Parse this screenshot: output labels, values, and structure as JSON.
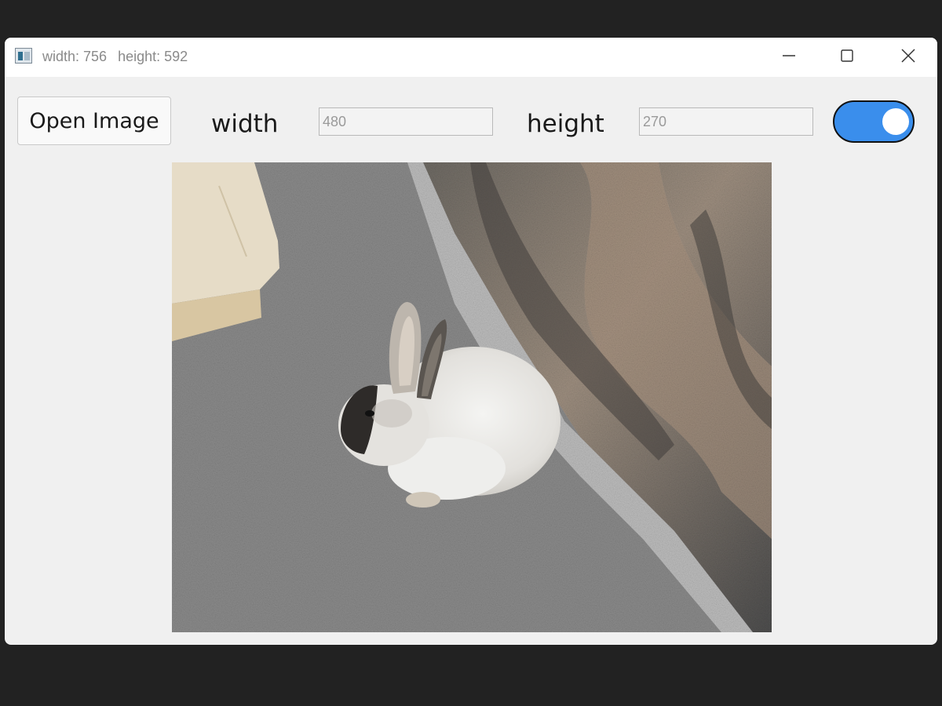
{
  "window": {
    "title_width": "width: 756",
    "title_height": "height: 592",
    "icon": "app-window-icon",
    "controls": {
      "minimize_icon": "minimize-icon",
      "maximize_icon": "maximize-icon",
      "close_icon": "close-icon"
    }
  },
  "toolbar": {
    "open_label": "Open Image",
    "width_label": "width",
    "width_placeholder": "480",
    "height_label": "height",
    "height_placeholder": "270",
    "toggle_on": true,
    "toggle_color": "#3a8eec"
  },
  "image": {
    "subject": "rabbit-photo"
  }
}
